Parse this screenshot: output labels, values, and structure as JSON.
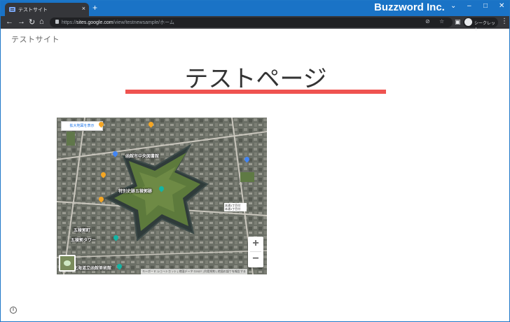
{
  "browser": {
    "tab_title": "テストサイト",
    "tab_close": "×",
    "new_tab": "+",
    "brand": "Buzzword Inc.",
    "url_prefix": "https://",
    "url_host": "sites.google.com",
    "url_path": "/view/testnewsample/ホーム",
    "incognito_label": "シークレット"
  },
  "site": {
    "name": "テストサイト",
    "page_title": "テストページ",
    "title_bar_color": "#ef5350"
  },
  "map": {
    "view_larger_label": "拡大地図を表示",
    "labels": {
      "library": "函館市中央図書館",
      "fort": "特別史跡五稜郭跡",
      "gorokaku_town": "五稜郭町",
      "tower": "五稜郭タワー",
      "art_museum": "北海道立函館美術館",
      "note": "本通1丁目付\n本通1丁目付"
    },
    "zoom_in": "+",
    "zoom_out": "−",
    "attribution": "キーボード ショートカット | 地図データ ©2022 | 利用規約 | 地図の誤りを報告する"
  },
  "footer": {
    "info_glyph": "i"
  }
}
